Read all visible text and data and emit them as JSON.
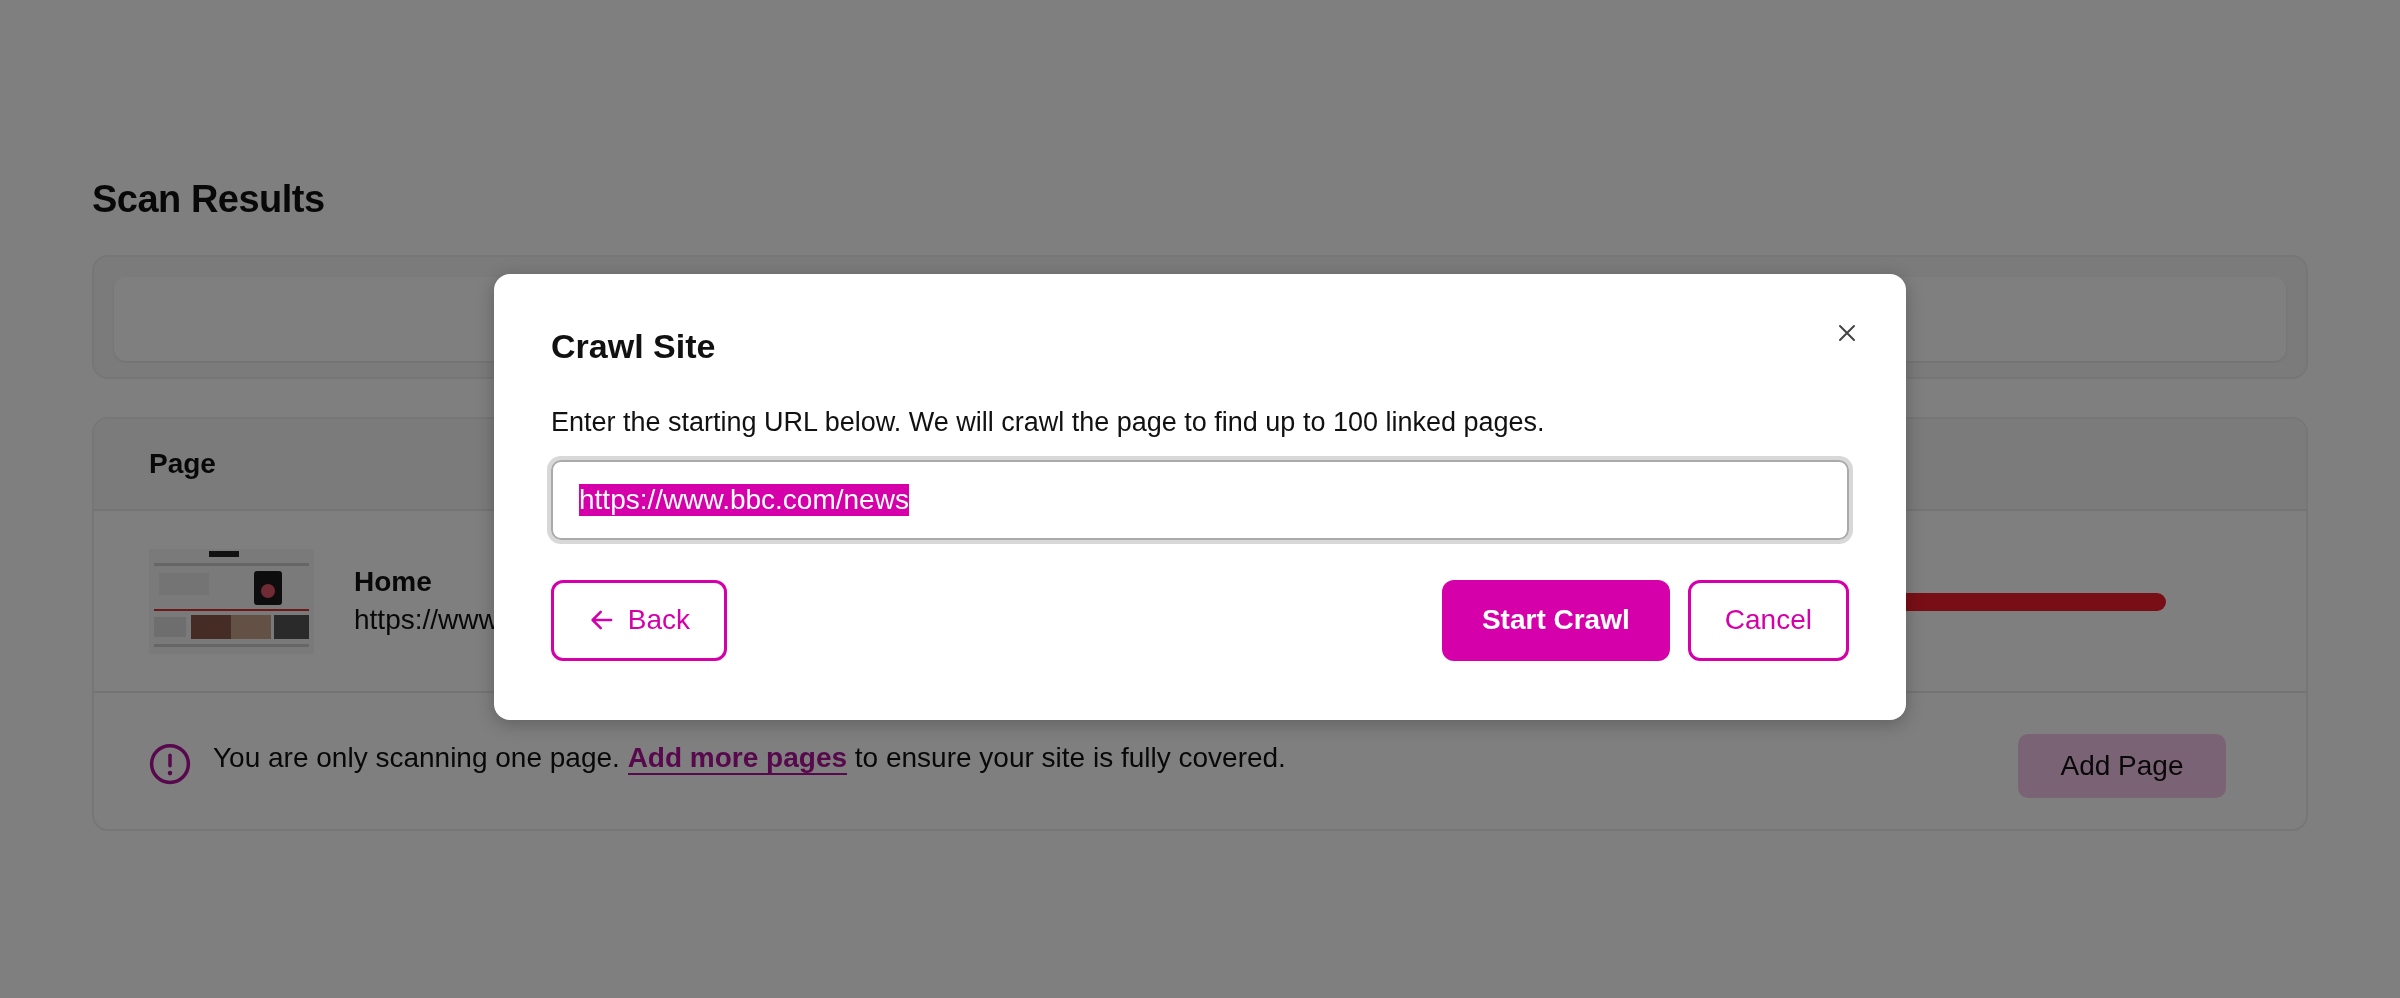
{
  "page": {
    "title": "Scan Results"
  },
  "table": {
    "columns": [
      "Page"
    ],
    "rows": [
      {
        "title": "Home",
        "url": "https://www"
      }
    ]
  },
  "notice": {
    "text_before": "You are only scanning one page.",
    "link": "Add more pages",
    "text_after": "to ensure your site is fully covered."
  },
  "add_page_button": "Add Page",
  "dialog": {
    "title": "Crawl Site",
    "description": "Enter the starting URL below. We will crawl the page to find up to 100 linked pages.",
    "url_field": {
      "value": "https://www.bbc.com/news",
      "text_selected": true
    },
    "buttons": [
      {
        "label": "Back",
        "kind": "back"
      },
      {
        "label": "Start Crawl",
        "kind": "primary"
      },
      {
        "label": "Cancel",
        "kind": "secondary"
      }
    ]
  }
}
